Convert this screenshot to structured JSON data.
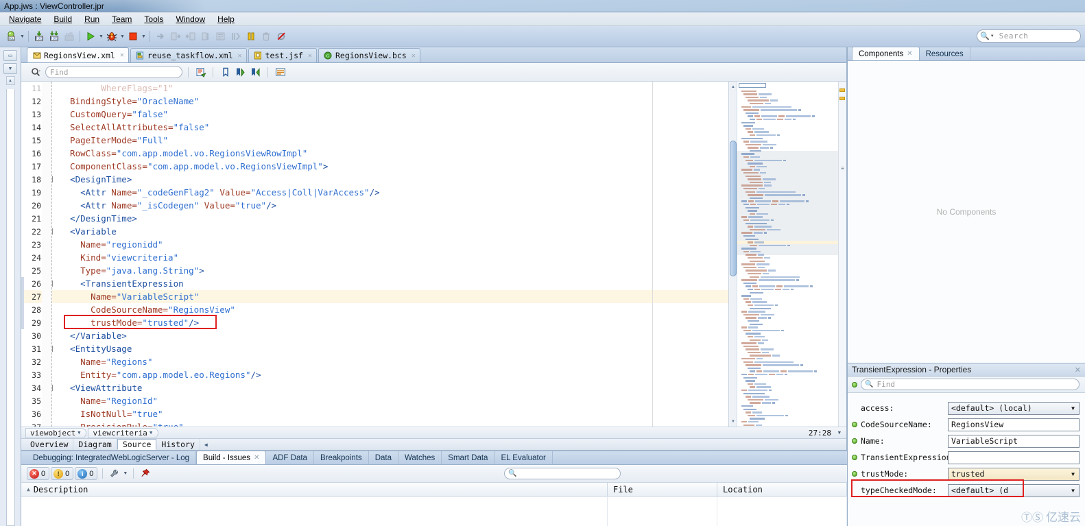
{
  "window": {
    "title": "App.jws : ViewController.jpr"
  },
  "menu": {
    "items": [
      "Navigate",
      "Build",
      "Run",
      "Team",
      "Tools",
      "Window",
      "Help"
    ]
  },
  "toolbar": {
    "icons": [
      {
        "name": "sql-console-icon"
      },
      {
        "name": "dropdown-caret-icon"
      },
      {
        "name": "make-icon"
      },
      {
        "name": "rebuild-icon"
      },
      {
        "name": "build-all-icon"
      },
      {
        "name": "run-icon"
      },
      {
        "name": "dropdown-caret-icon"
      },
      {
        "name": "debug-icon"
      },
      {
        "name": "dropdown-caret-icon"
      },
      {
        "name": "stop-icon"
      },
      {
        "name": "dropdown-caret-icon"
      },
      {
        "name": "step-into-icon"
      },
      {
        "name": "step-over-icon"
      },
      {
        "name": "step-out-icon"
      },
      {
        "name": "step-to-end-icon"
      },
      {
        "name": "resume-icon"
      },
      {
        "name": "run-to-cursor-icon"
      },
      {
        "name": "pause-icon"
      },
      {
        "name": "trash-icon"
      },
      {
        "name": "disable-breakpoints-icon"
      }
    ],
    "search": {
      "placeholder": "Search",
      "icon": "search-icon"
    }
  },
  "editor": {
    "file_tabs": [
      {
        "label": "RegionsView.xml",
        "icon": "xml-file-icon",
        "active": true,
        "closable": true
      },
      {
        "label": "reuse_taskflow.xml",
        "icon": "taskflow-file-icon",
        "active": false,
        "closable": true
      },
      {
        "label": "test.jsf",
        "icon": "jsf-file-icon",
        "active": false,
        "closable": true
      },
      {
        "label": "RegionsView.bcs",
        "icon": "bcs-file-icon",
        "active": false,
        "closable": true
      }
    ],
    "findbar": {
      "placeholder": "Find",
      "icons": [
        "search-dropdown-icon",
        "toggle-highlight-icon",
        "bookmark-icon",
        "next-bookmark-icon",
        "prev-bookmark-icon",
        "toggle-ruler-icon"
      ]
    },
    "lines": [
      {
        "no": 11,
        "fold": null,
        "clipped": true,
        "tokens": [
          {
            "t": "attr",
            "s": "        WhereFlags=\"1\""
          }
        ]
      },
      {
        "no": 12,
        "fold": null,
        "tokens": [
          {
            "t": "attr",
            "s": "  BindingStyle="
          },
          {
            "t": "val",
            "s": "\"OracleName\""
          }
        ]
      },
      {
        "no": 13,
        "fold": null,
        "tokens": [
          {
            "t": "attr",
            "s": "  CustomQuery="
          },
          {
            "t": "val",
            "s": "\"false\""
          }
        ]
      },
      {
        "no": 14,
        "fold": null,
        "tokens": [
          {
            "t": "attr",
            "s": "  SelectAllAttributes="
          },
          {
            "t": "val",
            "s": "\"false\""
          }
        ]
      },
      {
        "no": 15,
        "fold": null,
        "tokens": [
          {
            "t": "attr",
            "s": "  PageIterMode="
          },
          {
            "t": "val",
            "s": "\"Full\""
          }
        ]
      },
      {
        "no": 16,
        "fold": null,
        "tokens": [
          {
            "t": "attr",
            "s": "  RowClass="
          },
          {
            "t": "val",
            "s": "\"com.app.model.vo.RegionsViewRowImpl\""
          }
        ]
      },
      {
        "no": 17,
        "fold": null,
        "tokens": [
          {
            "t": "attr",
            "s": "  ComponentClass="
          },
          {
            "t": "val",
            "s": "\"com.app.model.vo.RegionsViewImpl\""
          },
          {
            "t": "tag",
            "s": ">"
          }
        ]
      },
      {
        "no": 18,
        "fold": "-",
        "tokens": [
          {
            "t": "tag",
            "s": "  <DesignTime>"
          }
        ]
      },
      {
        "no": 19,
        "fold": null,
        "tokens": [
          {
            "t": "tag",
            "s": "    <Attr "
          },
          {
            "t": "attr",
            "s": "Name="
          },
          {
            "t": "val",
            "s": "\"_codeGenFlag2\""
          },
          {
            "t": "attr",
            "s": " Value="
          },
          {
            "t": "val",
            "s": "\"Access|Coll|VarAccess\""
          },
          {
            "t": "tag",
            "s": "/>"
          }
        ]
      },
      {
        "no": 20,
        "fold": null,
        "tokens": [
          {
            "t": "tag",
            "s": "    <Attr "
          },
          {
            "t": "attr",
            "s": "Name="
          },
          {
            "t": "val",
            "s": "\"_isCodegen\""
          },
          {
            "t": "attr",
            "s": " Value="
          },
          {
            "t": "val",
            "s": "\"true\""
          },
          {
            "t": "tag",
            "s": "/>"
          }
        ]
      },
      {
        "no": 21,
        "fold": null,
        "tokens": [
          {
            "t": "tag",
            "s": "  </DesignTime>"
          }
        ]
      },
      {
        "no": 22,
        "fold": "-",
        "tokens": [
          {
            "t": "tag",
            "s": "  <Variable"
          }
        ]
      },
      {
        "no": 23,
        "fold": null,
        "tokens": [
          {
            "t": "attr",
            "s": "    Name="
          },
          {
            "t": "val",
            "s": "\"regionidd\""
          }
        ]
      },
      {
        "no": 24,
        "fold": null,
        "tokens": [
          {
            "t": "attr",
            "s": "    Kind="
          },
          {
            "t": "val",
            "s": "\"viewcriteria\""
          }
        ]
      },
      {
        "no": 25,
        "fold": null,
        "tokens": [
          {
            "t": "attr",
            "s": "    Type="
          },
          {
            "t": "val",
            "s": "\"java.lang.String\""
          },
          {
            "t": "tag",
            "s": ">"
          }
        ]
      },
      {
        "no": 26,
        "fold": "-",
        "tokens": [
          {
            "t": "tag",
            "s": "    <TransientExpression"
          }
        ]
      },
      {
        "no": 27,
        "fold": null,
        "highlight": true,
        "tokens": [
          {
            "t": "attr",
            "s": "      Name="
          },
          {
            "t": "val",
            "s": "\"VariableScript\""
          }
        ]
      },
      {
        "no": 28,
        "fold": null,
        "tokens": [
          {
            "t": "attr",
            "s": "      CodeSourceName="
          },
          {
            "t": "val",
            "s": "\"RegionsView\""
          }
        ]
      },
      {
        "no": 29,
        "fold": null,
        "boxed": true,
        "tokens": [
          {
            "t": "attr",
            "s": "      trustMode="
          },
          {
            "t": "val",
            "s": "\"trusted\""
          },
          {
            "t": "tag",
            "s": "/>"
          }
        ]
      },
      {
        "no": 30,
        "fold": null,
        "tokens": [
          {
            "t": "tag",
            "s": "  </Variable>"
          }
        ]
      },
      {
        "no": 31,
        "fold": "-",
        "tokens": [
          {
            "t": "tag",
            "s": "  <EntityUsage"
          }
        ]
      },
      {
        "no": 32,
        "fold": null,
        "tokens": [
          {
            "t": "attr",
            "s": "    Name="
          },
          {
            "t": "val",
            "s": "\"Regions\""
          }
        ]
      },
      {
        "no": 33,
        "fold": null,
        "tokens": [
          {
            "t": "attr",
            "s": "    Entity="
          },
          {
            "t": "val",
            "s": "\"com.app.model.eo.Regions\""
          },
          {
            "t": "tag",
            "s": "/>"
          }
        ]
      },
      {
        "no": 34,
        "fold": "-",
        "tokens": [
          {
            "t": "tag",
            "s": "  <ViewAttribute"
          }
        ]
      },
      {
        "no": 35,
        "fold": null,
        "tokens": [
          {
            "t": "attr",
            "s": "    Name="
          },
          {
            "t": "val",
            "s": "\"RegionId\""
          }
        ]
      },
      {
        "no": 36,
        "fold": null,
        "tokens": [
          {
            "t": "attr",
            "s": "    IsNotNull="
          },
          {
            "t": "val",
            "s": "\"true\""
          }
        ]
      },
      {
        "no": 37,
        "fold": null,
        "clipped": true,
        "tokens": [
          {
            "t": "attr",
            "s": "    PrecisionRule="
          },
          {
            "t": "val",
            "s": "\"true\""
          }
        ]
      }
    ],
    "breadcrumb": [
      {
        "label": "viewobject",
        "caret": "▼"
      },
      {
        "label": "viewcriteria",
        "caret": "▼"
      }
    ],
    "cursor_position": "27:28",
    "view_tabs": [
      {
        "label": "Overview",
        "active": false
      },
      {
        "label": "Diagram",
        "active": false
      },
      {
        "label": "Source",
        "active": true
      },
      {
        "label": "History",
        "active": false
      }
    ]
  },
  "right_dock": {
    "tabs": [
      {
        "label": "Components",
        "active": true,
        "closable": true
      },
      {
        "label": "Resources",
        "active": false,
        "closable": false
      }
    ],
    "empty_message": "No Components",
    "properties": {
      "title": "TransientExpression - Properties",
      "find_placeholder": "Find",
      "rows": [
        {
          "label": "access:",
          "value": "<default> (local)",
          "type": "combo",
          "bullet": false,
          "highlight": false
        },
        {
          "label": "CodeSourceName:",
          "value": "RegionsView",
          "type": "text",
          "bullet": true,
          "highlight": false
        },
        {
          "label": "Name:",
          "value": "VariableScript",
          "type": "text",
          "bullet": true,
          "highlight": false
        },
        {
          "label": "TransientExpression:",
          "value": "",
          "type": "text",
          "bullet": true,
          "highlight": false
        },
        {
          "label": "trustMode:",
          "value": "trusted",
          "type": "combo",
          "bullet": true,
          "highlight": true
        },
        {
          "label": "typeCheckedMode:",
          "value": "<default> (d",
          "type": "combo",
          "bullet": false,
          "highlight": false
        }
      ]
    }
  },
  "bottom_dock": {
    "tabs": [
      {
        "label": "Debugging: IntegratedWebLogicServer - Log",
        "active": false,
        "closable": false
      },
      {
        "label": "Build - Issues",
        "active": true,
        "closable": true
      },
      {
        "label": "ADF Data",
        "active": false,
        "closable": false
      },
      {
        "label": "Breakpoints",
        "active": false,
        "closable": false
      },
      {
        "label": "Data",
        "active": false,
        "closable": false
      },
      {
        "label": "Watches",
        "active": false,
        "closable": false
      },
      {
        "label": "Smart Data",
        "active": false,
        "closable": false
      },
      {
        "label": "EL Evaluator",
        "active": false,
        "closable": false
      }
    ],
    "counters": [
      {
        "name": "error-count",
        "value": "0",
        "color": "#cf1a1a",
        "icon": "error-icon"
      },
      {
        "name": "warning-count",
        "value": "0",
        "color": "#e8b400",
        "icon": "warning-icon"
      },
      {
        "name": "info-count",
        "value": "0",
        "color": "#2a7fd4",
        "icon": "info-icon"
      }
    ],
    "tool_icons": [
      "wrench-icon",
      "dropdown-caret-icon",
      "pin-icon"
    ],
    "search_icon": "search-icon",
    "columns": [
      {
        "label": "Description",
        "sort": "▲"
      },
      {
        "label": "File",
        "sort": ""
      },
      {
        "label": "Location",
        "sort": ""
      }
    ]
  },
  "watermark": {
    "text": "亿速云"
  },
  "colors": {
    "accent_blue": "#7fa0c4",
    "tag": "#1d4fa0",
    "attribute": "#9e3a24",
    "value": "#2f6fd0",
    "highlight_row": "#fdf6e3",
    "red_box": "#e02020"
  }
}
